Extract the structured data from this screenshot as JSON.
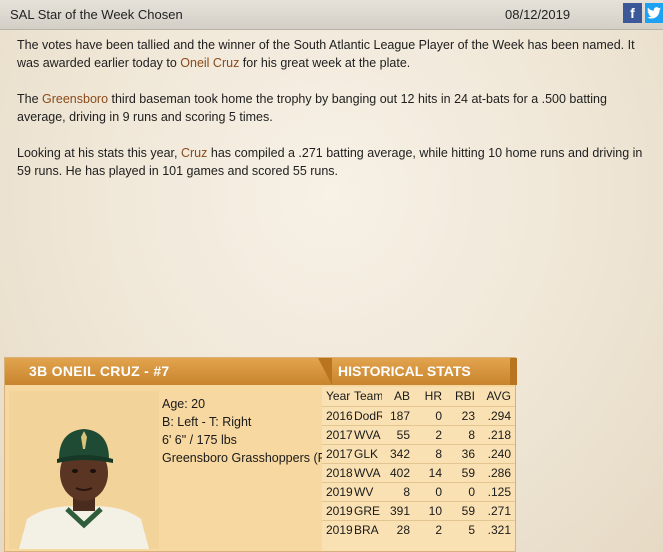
{
  "header": {
    "title": "SAL Star of the Week Chosen",
    "date": "08/12/2019",
    "facebook_label": "f",
    "twitter_icon": "twitter-bird-icon"
  },
  "article": {
    "p1_a": "The votes have been tallied and the winner of the South Atlantic League Player of the Week has been named. It was awarded earlier today to ",
    "p1_link": "Oneil Cruz",
    "p1_b": " for his great week at the plate.",
    "p2_a": "The ",
    "p2_link": "Greensboro",
    "p2_b": " third baseman took home the trophy by banging out 12 hits in 24 at-bats for a .500 batting average, driving in 9 runs and scoring 5 times.",
    "p3_a": "Looking at his stats this year, ",
    "p3_link": "Cruz",
    "p3_b": " has compiled a .271 batting average, while hitting 10 home runs and driving in 59 runs. He has played in 101 games and scored 55 runs."
  },
  "card": {
    "player_title": "3B ONEIL CRUZ - #7",
    "stats_title": "HISTORICAL STATS",
    "age": "Age: 20",
    "bats_throws": "B: Left - T: Right",
    "height_weight": "6' 6\" / 175 lbs",
    "team": "Greensboro Grasshoppers (PIT A)"
  },
  "stats": {
    "headers": [
      "Year",
      "Team",
      "AB",
      "HR",
      "RBI",
      "AVG"
    ],
    "rows": [
      {
        "year": "2016",
        "team": "DodR",
        "ab": "187",
        "hr": "0",
        "rbi": "23",
        "avg": ".294"
      },
      {
        "year": "2017",
        "team": "WVA",
        "ab": "55",
        "hr": "2",
        "rbi": "8",
        "avg": ".218"
      },
      {
        "year": "2017",
        "team": "GLK",
        "ab": "342",
        "hr": "8",
        "rbi": "36",
        "avg": ".240"
      },
      {
        "year": "2018",
        "team": "WVA",
        "ab": "402",
        "hr": "14",
        "rbi": "59",
        "avg": ".286"
      },
      {
        "year": "2019",
        "team": "WV",
        "ab": "8",
        "hr": "0",
        "rbi": "0",
        "avg": ".125"
      },
      {
        "year": "2019",
        "team": "GRE",
        "ab": "391",
        "hr": "10",
        "rbi": "59",
        "avg": ".271"
      },
      {
        "year": "2019",
        "team": "BRA",
        "ab": "28",
        "hr": "2",
        "rbi": "5",
        "avg": ".321"
      }
    ]
  }
}
